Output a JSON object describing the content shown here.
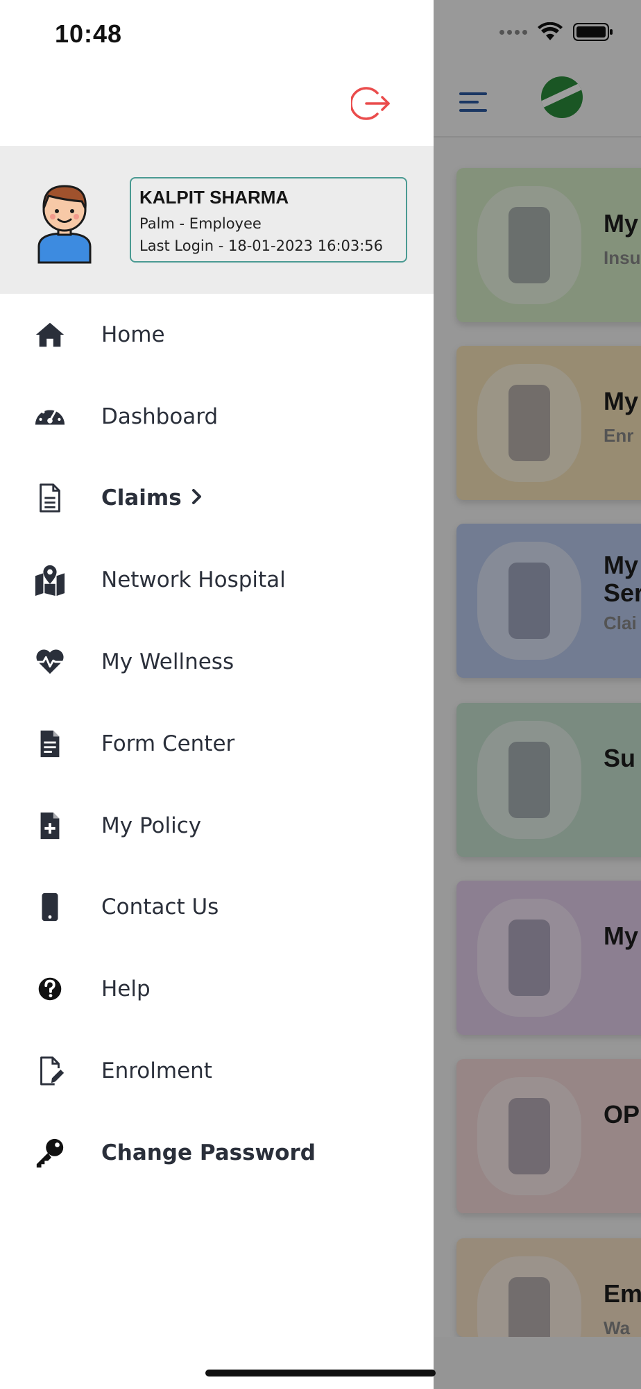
{
  "status": {
    "time": "10:48"
  },
  "profile": {
    "name": "KALPIT SHARMA",
    "role": "Palm - Employee",
    "last_login": "Last Login - 18-01-2023 16:03:56"
  },
  "menu": [
    {
      "label": "Home",
      "icon": "home-icon",
      "bold": false
    },
    {
      "label": "Dashboard",
      "icon": "speedometer-icon",
      "bold": false
    },
    {
      "label": "Claims",
      "icon": "document-icon",
      "bold": true
    },
    {
      "label": "Network Hospital",
      "icon": "map-pin-icon",
      "bold": false
    },
    {
      "label": "My Wellness",
      "icon": "heartbeat-icon",
      "bold": false
    },
    {
      "label": "Form Center",
      "icon": "form-icon",
      "bold": false
    },
    {
      "label": "My Policy",
      "icon": "file-plus-icon",
      "bold": false
    },
    {
      "label": "Contact Us",
      "icon": "phone-icon",
      "bold": false
    },
    {
      "label": "Help",
      "icon": "help-circle-icon",
      "bold": false
    },
    {
      "label": "Enrolment",
      "icon": "edit-file-icon",
      "bold": false
    },
    {
      "label": "Change Password",
      "icon": "key-icon",
      "bold": true
    }
  ],
  "background_cards": [
    {
      "title": "My",
      "subtitle": "Insu",
      "color": "#d6ecc7"
    },
    {
      "title": "My",
      "subtitle": "Enr",
      "color": "#f6e3b8"
    },
    {
      "title": "My\nSer",
      "subtitle": "Clai",
      "color": "#b9c9ec"
    },
    {
      "title": "Su",
      "subtitle": "",
      "color": "#c6e0cf"
    },
    {
      "title": "My",
      "subtitle": "",
      "color": "#e3cdeb"
    },
    {
      "title": "OP",
      "subtitle": "",
      "color": "#f4d8d8"
    },
    {
      "title": "Em",
      "subtitle": "Wa",
      "color": "#f6e0c6"
    }
  ],
  "colors": {
    "logout": "#ea4c4c",
    "accent_teal": "#4a9a92",
    "icon_dark": "#2a2f3a",
    "hamburger": "#2c5aa0"
  }
}
